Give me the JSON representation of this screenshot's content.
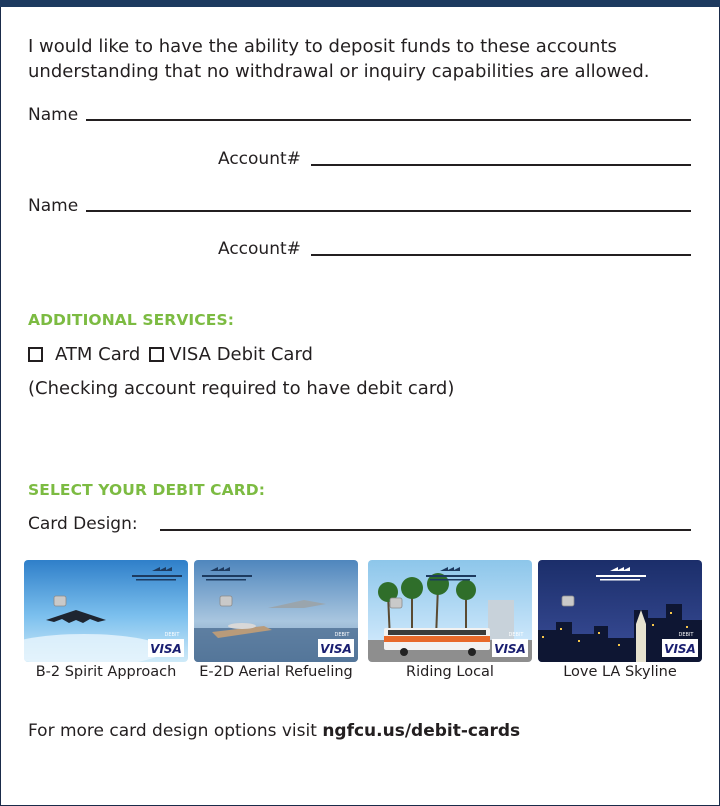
{
  "intro": "I would like to have the ability to deposit funds to these accounts understanding that no withdrawal or inquiry capabilities are allowed.",
  "fields": {
    "name_label": "Name",
    "account_label": "Account#",
    "card_design_label": "Card Design:"
  },
  "additional_services": {
    "heading": "ADDITIONAL SERVICES:",
    "options": [
      "ATM Card",
      "VISA Debit Card"
    ],
    "note": "(Checking account required to have debit card)"
  },
  "debit_card": {
    "heading": "SELECT YOUR DEBIT CARD:",
    "issuer": "NORTHROP GRUMMAN FEDERAL CREDIT UNION",
    "card_type": "DEBIT",
    "network": "VISA",
    "designs": [
      "B-2 Spirit Approach",
      "E-2D Aerial Refueling",
      "Riding Local",
      "Love LA Skyline"
    ]
  },
  "footer": {
    "text": "For more card design options visit ",
    "link": "ngfcu.us/debit-cards"
  },
  "colors": {
    "accent_green": "#7cbb42",
    "navy": "#1d3a5f",
    "text": "#231f20"
  }
}
